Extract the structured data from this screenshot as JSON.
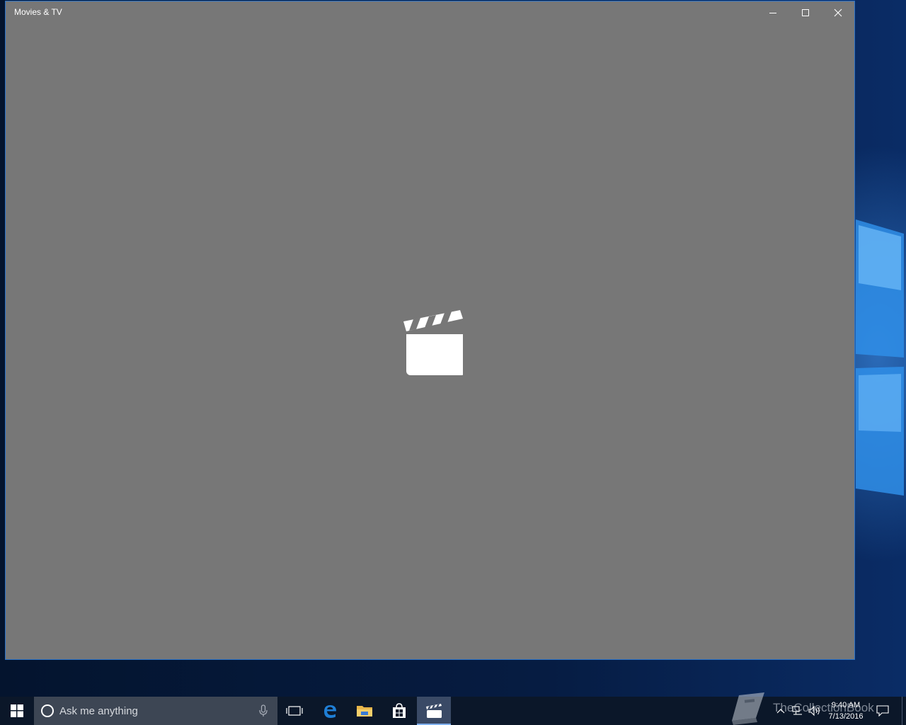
{
  "window": {
    "title": "Movies & TV",
    "background_color": "#777777",
    "border_color": "#2b73c9",
    "controls": [
      "minimize-icon",
      "maximize-icon",
      "close-icon"
    ],
    "splash_icon": "clapperboard-icon"
  },
  "taskbar": {
    "start_icon": "windows-logo-icon",
    "search": {
      "placeholder": "Ask me anything",
      "cortana_icon": "cortana-circle-icon",
      "mic_icon": "microphone-icon"
    },
    "pinned_apps": [
      {
        "name": "Task View",
        "icon": "task-view-icon"
      },
      {
        "name": "Microsoft Edge",
        "icon": "edge-icon"
      },
      {
        "name": "File Explorer",
        "icon": "folder-icon"
      },
      {
        "name": "Store",
        "icon": "store-icon"
      },
      {
        "name": "Movies & TV",
        "icon": "clapperboard-icon",
        "active": true
      }
    ],
    "tray": {
      "icons": [
        "chevron-up-icon",
        "network-icon",
        "volume-icon",
        "action-center-icon"
      ],
      "time": "9:40 AM",
      "date": "7/13/2016"
    }
  },
  "watermark": {
    "text": "TheCollectionBook",
    "icon": "book-icon"
  }
}
